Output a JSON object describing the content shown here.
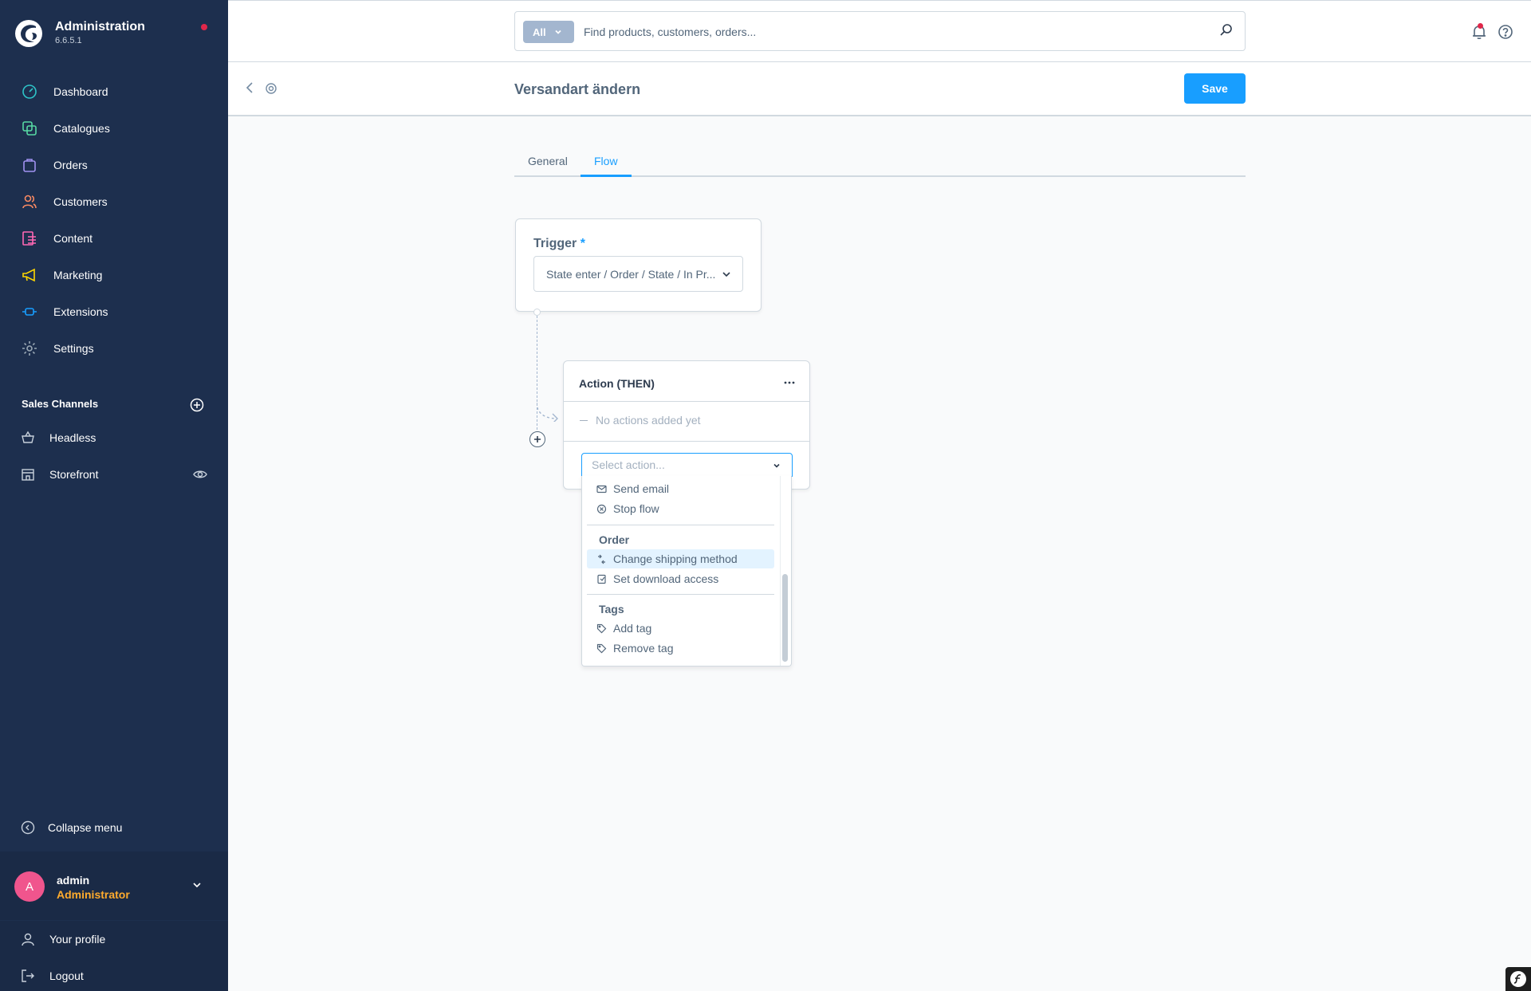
{
  "app": {
    "title": "Administration",
    "version": "6.6.5.1"
  },
  "nav": {
    "items": [
      {
        "label": "Dashboard",
        "icon": "dashboard-icon",
        "color": "#2ec4c8"
      },
      {
        "label": "Catalogues",
        "icon": "catalogue-icon",
        "color": "#57d9a3"
      },
      {
        "label": "Orders",
        "icon": "orders-icon",
        "color": "#a092f0"
      },
      {
        "label": "Customers",
        "icon": "customers-icon",
        "color": "#f88962"
      },
      {
        "label": "Content",
        "icon": "content-icon",
        "color": "#ff68b4"
      },
      {
        "label": "Marketing",
        "icon": "marketing-icon",
        "color": "#ffd700"
      },
      {
        "label": "Extensions",
        "icon": "extensions-icon",
        "color": "#189eff"
      },
      {
        "label": "Settings",
        "icon": "settings-icon",
        "color": "#9aa8b5"
      }
    ]
  },
  "sales_channels": {
    "title": "Sales Channels",
    "items": [
      {
        "label": "Headless"
      },
      {
        "label": "Storefront"
      }
    ]
  },
  "collapse_label": "Collapse menu",
  "user": {
    "initial": "A",
    "name": "admin",
    "role": "Administrator"
  },
  "user_links": {
    "profile": "Your profile",
    "logout": "Logout"
  },
  "search": {
    "type_label": "All",
    "placeholder": "Find products, customers, orders..."
  },
  "page": {
    "title": "Versandart ändern",
    "save_label": "Save"
  },
  "tabs": [
    {
      "label": "General"
    },
    {
      "label": "Flow"
    }
  ],
  "trigger": {
    "label": "Trigger",
    "required_mark": "*",
    "value": "State enter / Order / State / In Pr..."
  },
  "action_card": {
    "title": "Action (THEN)",
    "empty_text": "No actions added yet",
    "select_placeholder": "Select action..."
  },
  "dropdown": {
    "items_top": [
      {
        "label": "Send email",
        "icon": "mail-icon"
      },
      {
        "label": "Stop flow",
        "icon": "stop-icon"
      }
    ],
    "groups": [
      {
        "title": "Order",
        "items": [
          {
            "label": "Change shipping method",
            "icon": "shipping-icon"
          },
          {
            "label": "Set download access",
            "icon": "download-access-icon"
          }
        ]
      },
      {
        "title": "Tags",
        "items": [
          {
            "label": "Add tag",
            "icon": "tag-icon"
          },
          {
            "label": "Remove tag",
            "icon": "tag-icon"
          }
        ]
      }
    ]
  },
  "colors": {
    "accent": "#189eff",
    "sidebar": "#1d2f4e",
    "role": "#ffab2d",
    "avatar": "#f0558d"
  }
}
